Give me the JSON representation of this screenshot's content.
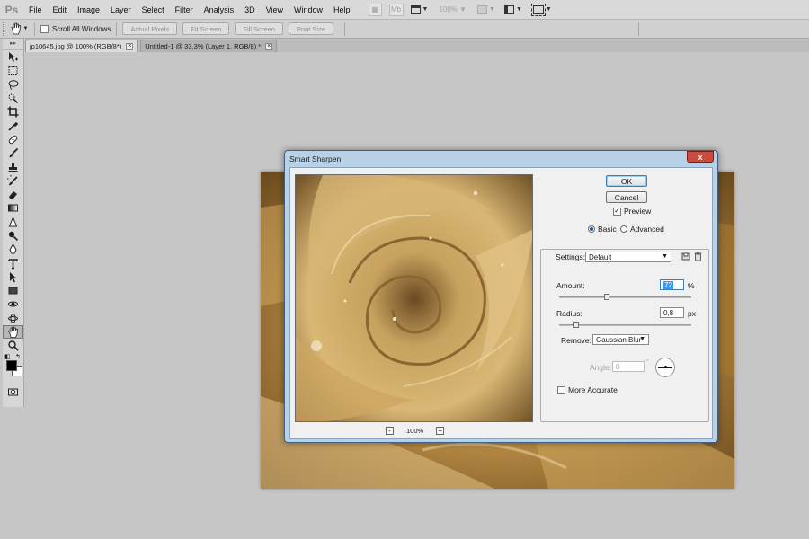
{
  "app": {
    "logo": "Ps"
  },
  "menus": [
    "File",
    "Edit",
    "Image",
    "Layer",
    "Select",
    "Filter",
    "Analysis",
    "3D",
    "View",
    "Window",
    "Help"
  ],
  "menubar_tools": {
    "bridge_icon": "bridge-icon",
    "minibridge_label": "Mb",
    "zoom": "100%"
  },
  "options_bar": {
    "scroll_all_windows": "Scroll All Windows",
    "actual_pixels": "Actual Pixels",
    "fit_screen": "Fit Screen",
    "fill_screen": "Fill Screen",
    "print_size": "Print Size"
  },
  "tabs": [
    {
      "label": "jp10645.jpg @ 100% (RGB/8*)",
      "active": true
    },
    {
      "label": "Untitled-1 @ 33,3% (Layer 1, RGB/8) *",
      "active": false
    }
  ],
  "tools": [
    "move-tool-icon",
    "marquee-tool-icon",
    "lasso-tool-icon",
    "quick-select-tool-icon",
    "crop-tool-icon",
    "eyedropper-tool-icon",
    "healing-brush-tool-icon",
    "brush-tool-icon",
    "clone-stamp-tool-icon",
    "history-brush-tool-icon",
    "eraser-tool-icon",
    "gradient-tool-icon",
    "blur-tool-icon",
    "dodge-tool-icon",
    "pen-tool-icon",
    "type-tool-icon",
    "path-select-tool-icon",
    "shape-tool-icon",
    "3d-rotate-tool-icon",
    "3d-orbit-tool-icon",
    "hand-tool-icon",
    "zoom-tool-icon"
  ],
  "colors": {
    "foreground": "#000000",
    "background": "#ffffff"
  },
  "dialog": {
    "title": "Smart Sharpen",
    "close": "x",
    "ok": "OK",
    "cancel": "Cancel",
    "preview_label": "Preview",
    "preview_checked": true,
    "mode_basic": "Basic",
    "mode_advanced": "Advanced",
    "mode_selected": "Basic",
    "settings_label": "Settings:",
    "settings_value": "Default",
    "amount_label": "Amount:",
    "amount_value": "72",
    "amount_unit": "%",
    "amount_level": 0.36,
    "radius_label": "Radius:",
    "radius_value": "0,8",
    "radius_unit": "px",
    "radius_level": 0.13,
    "remove_label": "Remove:",
    "remove_value": "Gaussian Blur",
    "angle_label": "Angle:",
    "angle_value": "0",
    "angle_unit": "°",
    "more_accurate": "More Accurate",
    "more_accurate_checked": false,
    "zoom_minus": "-",
    "zoom_value": "100%",
    "zoom_plus": "+"
  }
}
